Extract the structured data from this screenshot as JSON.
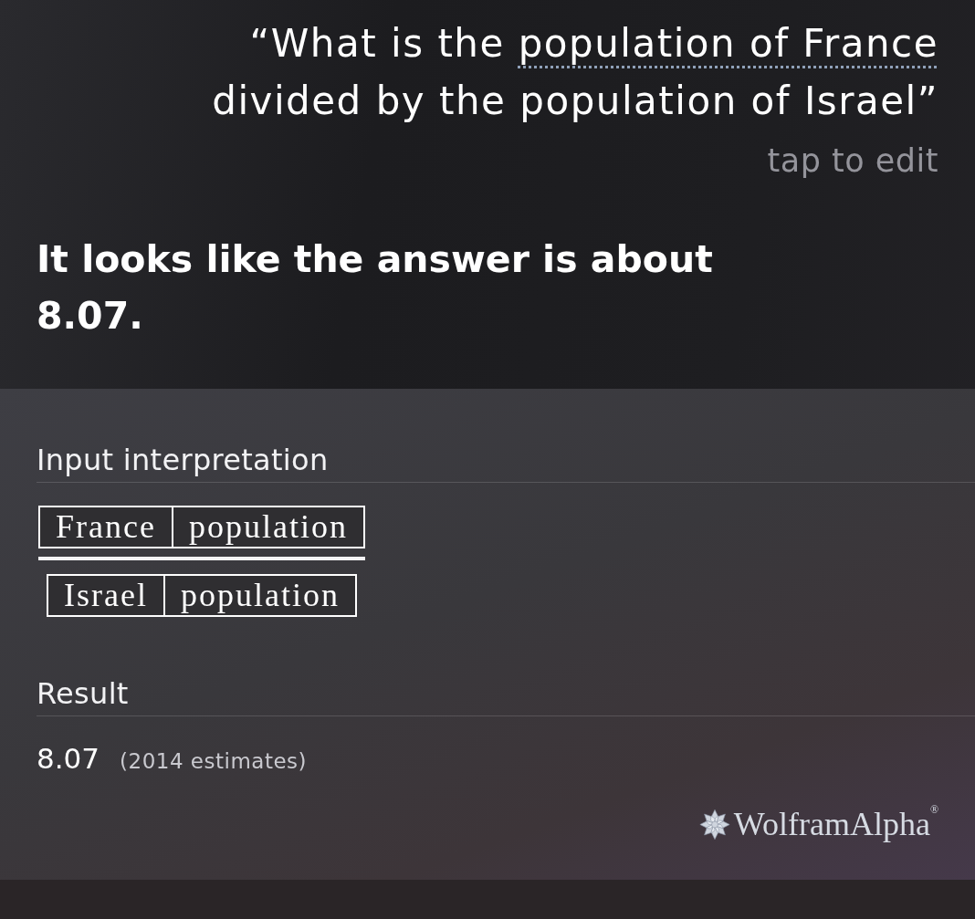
{
  "query": {
    "segments": [
      {
        "text": "“What is the ",
        "underlined": false
      },
      {
        "text": "population of France",
        "underlined": true
      },
      {
        "text": " divided by the population of Israel”",
        "underlined": false
      }
    ]
  },
  "edit_hint": "tap to edit",
  "answer": "It looks like the answer is about 8.07.",
  "card": {
    "sections": [
      {
        "kind": "interpretation",
        "title": "Input interpretation",
        "numerator": [
          "France",
          "population"
        ],
        "denominator": [
          "Israel",
          "population"
        ]
      },
      {
        "kind": "result",
        "title": "Result",
        "value": "8.07",
        "note": "(2014 estimates)"
      }
    ],
    "logo": {
      "text": "WolframAlpha$^{®}$"
    }
  }
}
